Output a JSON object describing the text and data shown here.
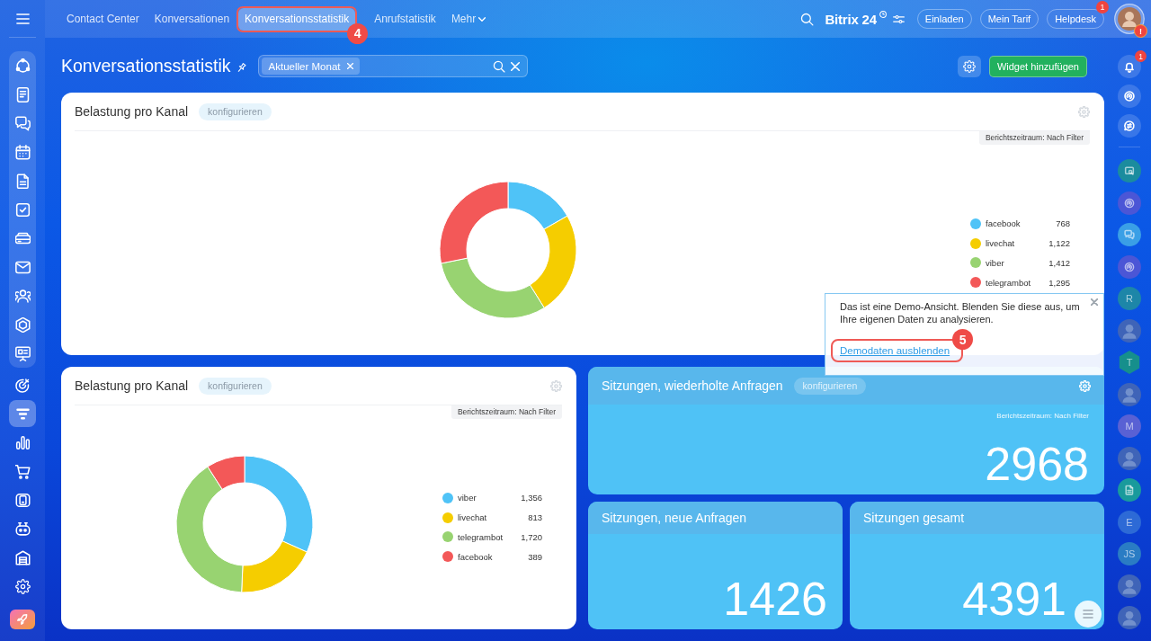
{
  "top_nav": {
    "tabs": [
      {
        "label": "Contact Center",
        "selected": false
      },
      {
        "label": "Konversationen",
        "selected": false
      },
      {
        "label": "Konversationsstatistik",
        "selected": true,
        "callout": "4"
      },
      {
        "label": "Anrufstatistik",
        "selected": false
      }
    ],
    "more": "Mehr",
    "logo": "Bitrix 24",
    "buttons": [
      {
        "label": "Einladen"
      },
      {
        "label": "Mein Tarif"
      },
      {
        "label": "Helpdesk",
        "badge": "1"
      }
    ],
    "avatar_badge": "!"
  },
  "left_nav": {
    "group": [
      {
        "selected": false
      },
      {
        "selected": false
      },
      {
        "selected": false
      },
      {
        "selected": false
      },
      {
        "selected": false
      },
      {
        "selected": false
      },
      {
        "selected": false
      },
      {
        "selected": false
      },
      {
        "selected": false
      },
      {
        "selected": false
      },
      {
        "selected": false
      }
    ],
    "items": [
      {
        "selected": false
      },
      {
        "selected": true
      },
      {
        "selected": false
      },
      {
        "selected": false
      },
      {
        "selected": false
      },
      {
        "selected": false
      },
      {
        "selected": false
      },
      {
        "selected": false
      }
    ]
  },
  "page": {
    "title": "Konversationsstatistik",
    "filter_tags": [
      "Aktueller Monat"
    ],
    "add_widget": "Widget hinzufügen"
  },
  "widgets": [
    {
      "kind": "donut",
      "title": "Belastung pro Kanal",
      "configure": "konfigurieren",
      "period": "Berichtszeitraum: Nach Filter",
      "legend": [
        {
          "label": "facebook",
          "value": "768",
          "color": "#4fc3f7"
        },
        {
          "label": "livechat",
          "value": "1,122",
          "color": "#f5cd00"
        },
        {
          "label": "viber",
          "value": "1,412",
          "color": "#98d371"
        },
        {
          "label": "telegrambot",
          "value": "1,295",
          "color": "#f35858"
        }
      ],
      "chart_data": {
        "type": "donut",
        "values": [
          16.71,
          24.41,
          30.72,
          28.16
        ]
      }
    },
    {
      "kind": "donut",
      "title": "Belastung pro Kanal",
      "configure": "konfigurieren",
      "period": "Berichtszeitraum: Nach Filter",
      "legend": [
        {
          "label": "viber",
          "value": "1,356",
          "color": "#4fc3f7"
        },
        {
          "label": "livechat",
          "value": "813",
          "color": "#f5cd00"
        },
        {
          "label": "telegrambot",
          "value": "1,720",
          "color": "#98d371"
        },
        {
          "label": "facebook",
          "value": "389",
          "color": "#f35858"
        }
      ],
      "chart_data": {
        "type": "donut",
        "values": [
          31.7,
          19.0,
          40.21,
          9.09
        ]
      }
    },
    {
      "kind": "number",
      "title": "Sitzungen, wiederholte Anfragen",
      "configure": "konfigurieren",
      "period": "Berichtszeitraum: Nach Filter",
      "value": "2968"
    },
    {
      "kind": "number",
      "title": "Sitzungen, neue Anfragen",
      "value": "1426"
    },
    {
      "kind": "number",
      "title": "Sitzungen gesamt",
      "value": "4391"
    }
  ],
  "demo_popup": {
    "text": "Das ist eine Demo-Ansicht. Blenden Sie diese aus, um Ihre eigenen Daten zu analysieren.",
    "link": {
      "label": "Demodaten ausblenden",
      "callout": "5"
    }
  },
  "right_bar": {
    "notification_badge": "1",
    "chats": [
      {
        "kind": "app",
        "color": "#1b8c9e"
      },
      {
        "kind": "app",
        "color": "#4b56d6"
      },
      {
        "kind": "app",
        "color": "#3a9fe6"
      },
      {
        "kind": "app",
        "color": "#4b56d6"
      },
      {
        "kind": "letter",
        "text": "R",
        "color": "#1d86a8"
      },
      {
        "kind": "photo"
      },
      {
        "kind": "hex_letter",
        "text": "T",
        "color": "#168f8c"
      },
      {
        "kind": "photo"
      },
      {
        "kind": "letter",
        "text": "M",
        "color": "#5961d4"
      },
      {
        "kind": "photo"
      },
      {
        "kind": "app",
        "color": "#199a9c"
      },
      {
        "kind": "letter",
        "text": "E",
        "color": "#2d6ad6"
      },
      {
        "kind": "letter",
        "text": "JS",
        "color": "#2a7cc4"
      },
      {
        "kind": "photo"
      },
      {
        "kind": "photo"
      }
    ]
  }
}
